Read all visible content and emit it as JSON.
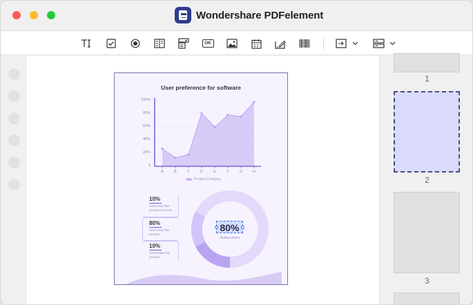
{
  "window": {
    "title": "Wondershare PDFelement"
  },
  "toolbar": {
    "tools": [
      {
        "name": "text-field-icon",
        "label": ""
      },
      {
        "name": "checkbox-icon",
        "label": ""
      },
      {
        "name": "radio-button-icon",
        "label": ""
      },
      {
        "name": "list-box-icon",
        "label": ""
      },
      {
        "name": "combo-box-icon",
        "label": ""
      },
      {
        "name": "button-icon",
        "label": "OK"
      },
      {
        "name": "image-field-icon",
        "label": ""
      },
      {
        "name": "date-field-icon",
        "label": ""
      },
      {
        "name": "signature-field-icon",
        "label": ""
      },
      {
        "name": "barcode-icon",
        "label": ""
      },
      {
        "name": "align-dropdown-icon",
        "label": ""
      },
      {
        "name": "distribute-dropdown-icon",
        "label": ""
      }
    ]
  },
  "document": {
    "chart_data": {
      "type": "area",
      "title": "User preference for software",
      "categories": [
        "A",
        "B",
        "C",
        "D",
        "E",
        "F",
        "G",
        "H"
      ],
      "series": [
        {
          "name": "Product Category",
          "values": [
            27,
            13,
            18,
            81,
            60,
            78,
            76,
            98
          ]
        }
      ],
      "yticks": [
        "0",
        "20%",
        "40%",
        "60%",
        "80%",
        "100%"
      ],
      "ylim": [
        0,
        100
      ],
      "legend": "bottom-center",
      "colors": {
        "fill": "#d7cbf7",
        "line": "#b9a6ef",
        "axis": "#7a68d9"
      }
    },
    "stats": [
      {
        "value": "10%",
        "desc": "Users love this product so much"
      },
      {
        "value": "80%",
        "desc": "Users love this product"
      },
      {
        "value": "10%",
        "desc": "Users hate this product"
      }
    ],
    "donut": {
      "value": "80%",
      "label": "Subscribers",
      "fraction": 0.8
    }
  },
  "thumbnails": [
    {
      "number": "1",
      "selected": false
    },
    {
      "number": "2",
      "selected": true
    },
    {
      "number": "3",
      "selected": false
    }
  ]
}
